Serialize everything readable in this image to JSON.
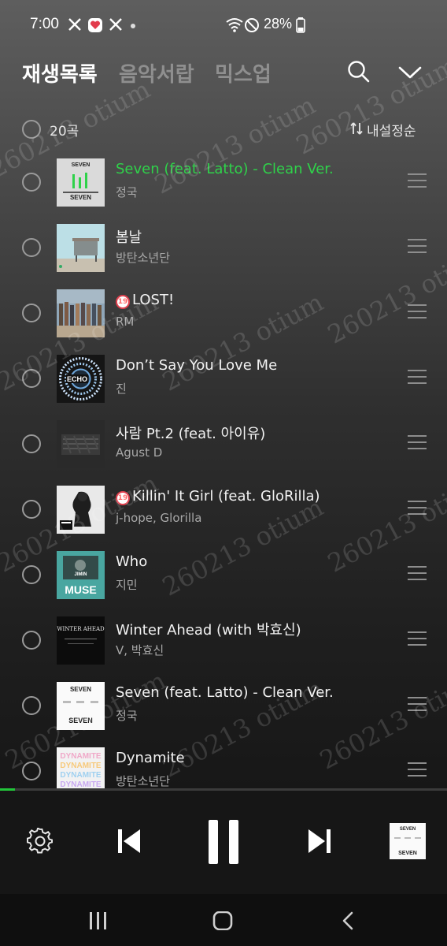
{
  "status_bar": {
    "time": "7:00",
    "battery": "28%",
    "icons": [
      "x-icon",
      "heart-app-icon",
      "x-icon",
      "notification-dot",
      "wifi-icon",
      "dnd-icon",
      "battery-icon"
    ]
  },
  "header": {
    "tabs": [
      {
        "label": "재생목록",
        "active": true
      },
      {
        "label": "음악서랍",
        "active": false
      },
      {
        "label": "믹스업",
        "active": false
      }
    ],
    "search_icon": "search-icon",
    "collapse_icon": "chevron-down-icon"
  },
  "list_header": {
    "count": "20곡",
    "sort_label": "내설정순",
    "sort_icon": "sort-icon"
  },
  "tracks": [
    {
      "title": "Seven (feat. Latto) - Clean Ver.",
      "artist": "정국",
      "playing": true,
      "explicit": false
    },
    {
      "title": "봄날",
      "artist": "방탄소년단",
      "playing": false,
      "explicit": false
    },
    {
      "title": "LOST!",
      "artist": "RM",
      "playing": false,
      "explicit": true
    },
    {
      "title": "Don’t Say You Love Me",
      "artist": "진",
      "playing": false,
      "explicit": false
    },
    {
      "title": "사람 Pt.2 (feat. 아이유)",
      "artist": "Agust D",
      "playing": false,
      "explicit": false
    },
    {
      "title": "Killin' It Girl (feat. GloRilla)",
      "artist": "j-hope, Glorilla",
      "playing": false,
      "explicit": true
    },
    {
      "title": "Who",
      "artist": "지민",
      "playing": false,
      "explicit": false
    },
    {
      "title": "Winter Ahead (with 박효신)",
      "artist": "V, 박효신",
      "playing": false,
      "explicit": false
    },
    {
      "title": "Seven (feat. Latto) - Clean Ver.",
      "artist": "정국",
      "playing": false,
      "explicit": false
    },
    {
      "title": "Dynamite",
      "artist": "방탄소년단",
      "playing": false,
      "explicit": false
    }
  ],
  "explicit_badge": "19",
  "cover_texts": {
    "seven": "SEVEN",
    "echo": "ECHO",
    "muse": "MUSE",
    "jimin": "JIMIN",
    "winter": "WINTER AHEAD",
    "dynamite": "DYNAMITE"
  },
  "playback": {
    "progress": 0.033,
    "state": "playing"
  },
  "player_icons": [
    "settings-icon",
    "previous-icon",
    "pause-icon",
    "next-icon"
  ],
  "watermark": "260213 otium",
  "colors": {
    "accent": "#2fd24a",
    "explicit": "#e0404e"
  }
}
